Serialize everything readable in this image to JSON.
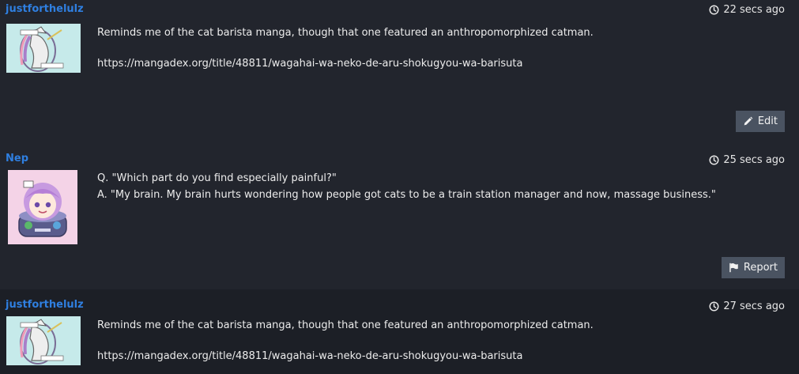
{
  "posts": [
    {
      "author": "justforthelulz",
      "time": "22 secs ago",
      "avatar": "unicorn-avatar",
      "lines": [
        "Reminds me of the cat barista manga, though that one featured an anthropomorphized catman.",
        "",
        "https://mangadex.org/title/48811/wagahai-wa-neko-de-aru-shokugyou-wa-barisuta"
      ],
      "action_label": "Edit",
      "action_icon": "pencil-icon"
    },
    {
      "author": "Nep",
      "time": "25 secs ago",
      "avatar": "anime-girl-avatar",
      "lines": [
        "Q. \"Which part do you find especially painful?\"",
        "A. \"My brain. My brain hurts wondering how people got cats to be a train station manager and now, massage business.\""
      ],
      "action_label": "Report",
      "action_icon": "flag-icon"
    },
    {
      "author": "justforthelulz",
      "time": "27 secs ago",
      "avatar": "unicorn-avatar",
      "lines": [
        "Reminds me of the cat barista manga, though that one featured an anthropomorphized catman.",
        "",
        "https://mangadex.org/title/48811/wagahai-wa-neko-de-aru-shokugyou-wa-barisuta"
      ]
    }
  ],
  "colors": {
    "author_link": "#2f7fe0",
    "button_bg": "#4a5361",
    "page_bg": "#22252d"
  }
}
